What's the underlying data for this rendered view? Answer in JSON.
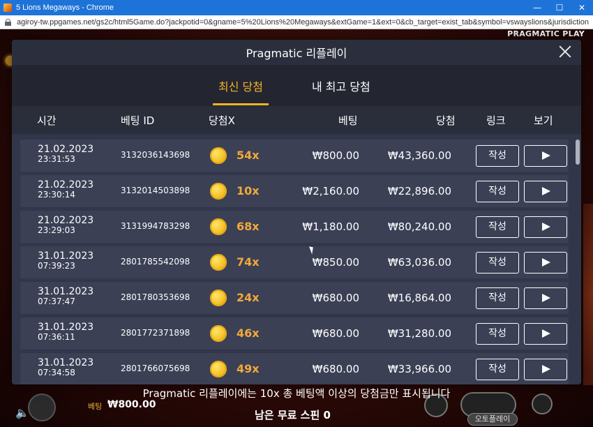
{
  "window": {
    "title": "5 Lions Megaways - Chrome",
    "url": "agiroy-tw.ppgames.net/gs2c/html5Game.do?jackpotid=0&gname=5%20Lions%20Megaways&extGame=1&ext=0&cb_target=exist_tab&symbol=vswayslions&jurisdictionID=99&minilob..."
  },
  "game": {
    "brand": "PRAGMATIC PLAY",
    "bet_label": "베팅",
    "bet_value": "₩800.00",
    "free_spins": "남은 무료 스핀 0",
    "autoplay_label": "오토플레이"
  },
  "modal": {
    "title": "Pragmatic 리플레이",
    "tabs": [
      {
        "label": "최신 당첨",
        "active": true
      },
      {
        "label": "내 최고 당첨",
        "active": false
      }
    ],
    "columns": {
      "time": "시간",
      "bet_id": "베팅 ID",
      "multiplier": "당첨X",
      "bet": "베팅",
      "win": "당첨",
      "link": "링크",
      "view": "보기"
    },
    "write_label": "작성",
    "rows": [
      {
        "date": "21.02.2023",
        "time": "23:31:53",
        "bet_id": "3132036143698",
        "multiplier": "54x",
        "bet": "₩800.00",
        "win": "₩43,360.00"
      },
      {
        "date": "21.02.2023",
        "time": "23:30:14",
        "bet_id": "3132014503898",
        "multiplier": "10x",
        "bet": "₩2,160.00",
        "win": "₩22,896.00"
      },
      {
        "date": "21.02.2023",
        "time": "23:29:03",
        "bet_id": "3131994783298",
        "multiplier": "68x",
        "bet": "₩1,180.00",
        "win": "₩80,240.00"
      },
      {
        "date": "31.01.2023",
        "time": "07:39:23",
        "bet_id": "2801785542098",
        "multiplier": "74x",
        "bet": "₩850.00",
        "win": "₩63,036.00"
      },
      {
        "date": "31.01.2023",
        "time": "07:37:47",
        "bet_id": "2801780353698",
        "multiplier": "24x",
        "bet": "₩680.00",
        "win": "₩16,864.00"
      },
      {
        "date": "31.01.2023",
        "time": "07:36:11",
        "bet_id": "2801772371898",
        "multiplier": "46x",
        "bet": "₩680.00",
        "win": "₩31,280.00"
      },
      {
        "date": "31.01.2023",
        "time": "07:34:58",
        "bet_id": "2801766075698",
        "multiplier": "49x",
        "bet": "₩680.00",
        "win": "₩33,966.00"
      }
    ],
    "footer_note": "Pragmatic 리플레이에는 10x 총 베팅액 이상의 당첨금만 표시됩니다"
  },
  "colors": {
    "accent": "#f5b325",
    "multiplier": "#f2a93a",
    "modal_bg": "#2d3140",
    "row_bg": "#3b4055"
  }
}
